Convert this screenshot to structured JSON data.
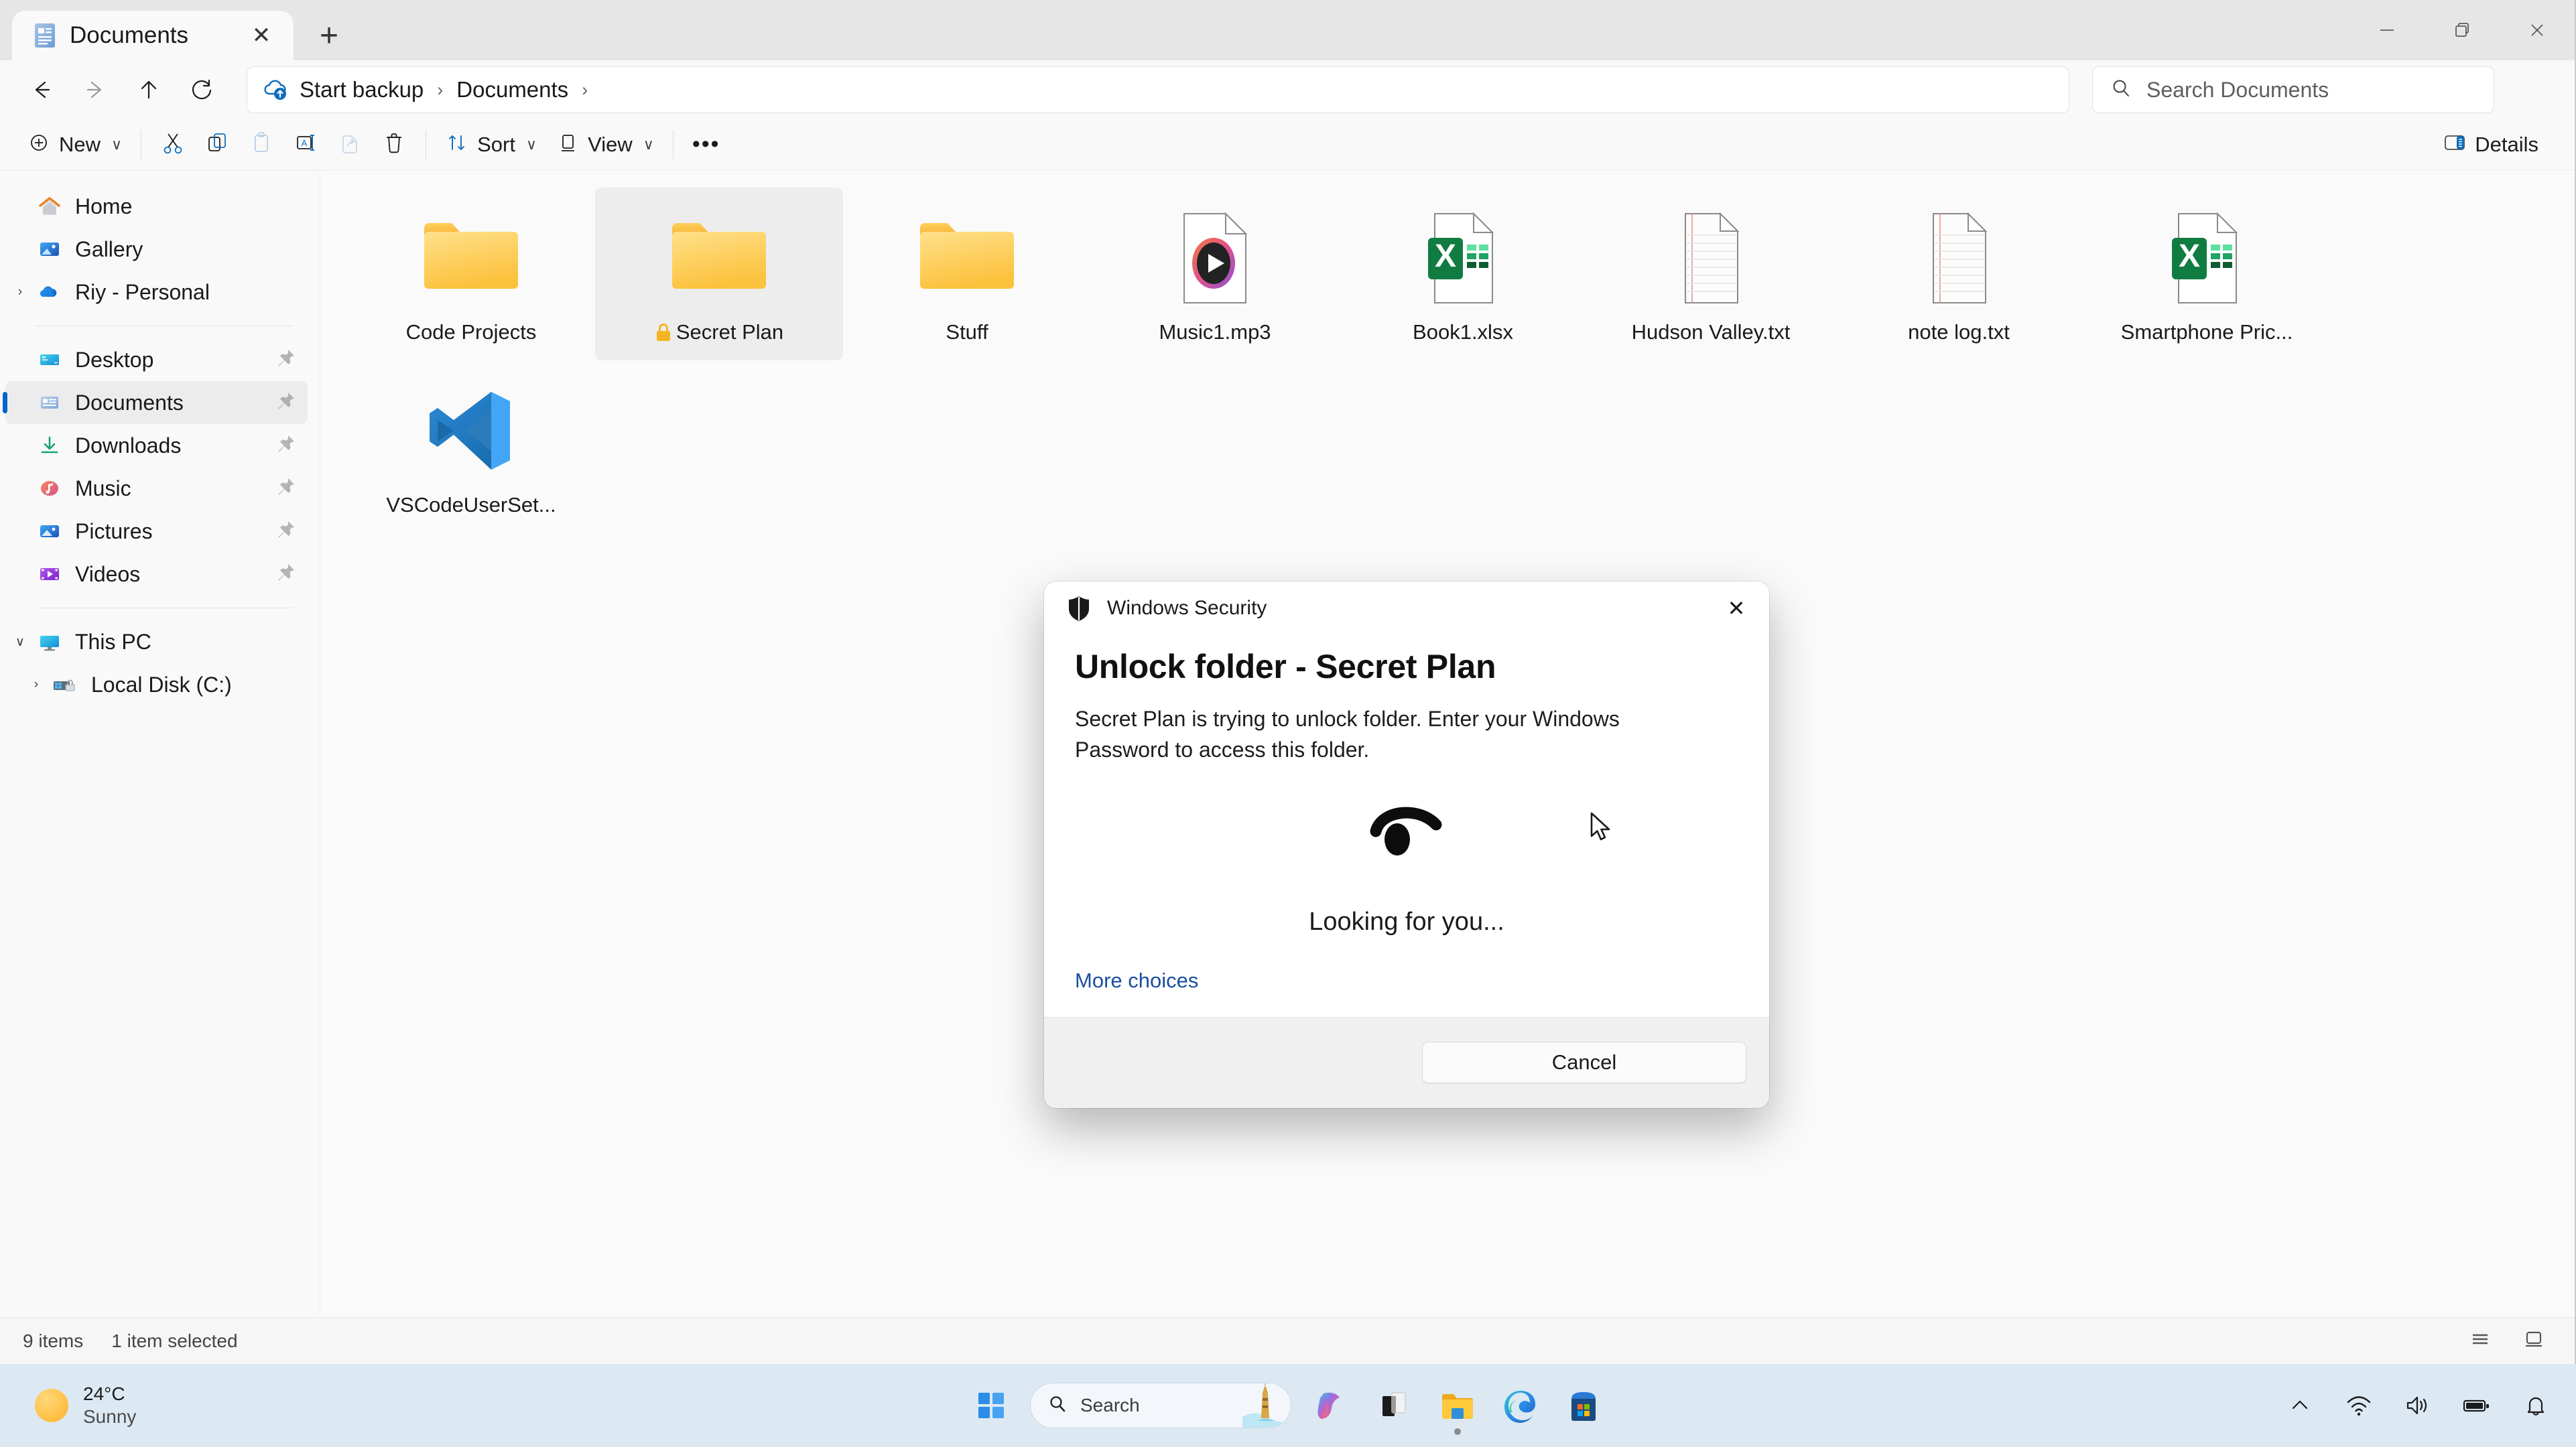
{
  "window": {
    "tab": {
      "label": "Documents",
      "icon": "documents-file-icon",
      "close_glyph": "✕"
    },
    "new_tab_glyph": "+",
    "controls": {
      "minimize": "minimize-icon",
      "maximize": "restore-icon",
      "close": "close-icon"
    }
  },
  "navbar": {
    "back": "back-arrow-icon",
    "forward": "forward-arrow-icon",
    "up": "up-arrow-icon",
    "refresh": "refresh-icon",
    "breadcrumbs": [
      {
        "label": "Start backup",
        "icon": "onedrive-backup-icon"
      },
      {
        "label": "Documents",
        "icon": ""
      }
    ],
    "separator": "›"
  },
  "search": {
    "placeholder": "Search Documents",
    "icon": "search-icon"
  },
  "toolbar": {
    "new_label": "New",
    "new_icon": "plus-circle-icon",
    "cut_icon": "scissors-icon",
    "copy_icon": "copy-icon",
    "paste_icon": "paste-icon",
    "rename_icon": "rename-icon",
    "share_icon": "share-icon",
    "delete_icon": "trash-icon",
    "sort_label": "Sort",
    "sort_icon": "sort-icon",
    "view_label": "View",
    "view_icon": "view-icon",
    "more_label": "•••",
    "details_label": "Details",
    "details_icon": "details-pane-icon",
    "chevron": "∨"
  },
  "sidebar": {
    "items": [
      {
        "name": "home",
        "label": "Home",
        "icon": "home-icon",
        "expander": "",
        "pinned": false,
        "selected": false,
        "indent": 1
      },
      {
        "name": "gallery",
        "label": "Gallery",
        "icon": "gallery-icon",
        "expander": "",
        "pinned": false,
        "selected": false,
        "indent": 1
      },
      {
        "name": "riy-personal",
        "label": "Riy - Personal",
        "icon": "onedrive-icon",
        "expander": "›",
        "pinned": false,
        "selected": false,
        "indent": 1
      },
      {
        "name": "divider-1",
        "label": "",
        "icon": "divider",
        "expander": "",
        "pinned": false,
        "selected": false,
        "indent": 0
      },
      {
        "name": "desktop",
        "label": "Desktop",
        "icon": "desktop-icon",
        "expander": "",
        "pinned": true,
        "selected": false,
        "indent": 1
      },
      {
        "name": "documents",
        "label": "Documents",
        "icon": "documents-icon",
        "expander": "",
        "pinned": true,
        "selected": true,
        "indent": 1
      },
      {
        "name": "downloads",
        "label": "Downloads",
        "icon": "downloads-icon",
        "expander": "",
        "pinned": true,
        "selected": false,
        "indent": 1
      },
      {
        "name": "music",
        "label": "Music",
        "icon": "music-icon",
        "expander": "",
        "pinned": true,
        "selected": false,
        "indent": 1
      },
      {
        "name": "pictures",
        "label": "Pictures",
        "icon": "pictures-icon",
        "expander": "",
        "pinned": true,
        "selected": false,
        "indent": 1
      },
      {
        "name": "videos",
        "label": "Videos",
        "icon": "videos-icon",
        "expander": "",
        "pinned": true,
        "selected": false,
        "indent": 1
      },
      {
        "name": "divider-2",
        "label": "",
        "icon": "divider",
        "expander": "",
        "pinned": false,
        "selected": false,
        "indent": 0
      },
      {
        "name": "this-pc",
        "label": "This PC",
        "icon": "this-pc-icon",
        "expander": "∨",
        "pinned": false,
        "selected": false,
        "indent": 1
      },
      {
        "name": "local-disk-c",
        "label": "Local Disk (C:)",
        "icon": "local-disk-icon",
        "expander": "›",
        "pinned": false,
        "selected": false,
        "indent": 2
      }
    ]
  },
  "files": [
    {
      "name": "Code Projects",
      "icon": "folder-icon",
      "selected": false,
      "lock": false
    },
    {
      "name": "Secret Plan",
      "icon": "folder-icon",
      "selected": true,
      "lock": true,
      "lock_glyph": "🔒"
    },
    {
      "name": "Stuff",
      "icon": "folder-icon",
      "selected": false,
      "lock": false
    },
    {
      "name": "Music1.mp3",
      "icon": "media-player-file-icon",
      "selected": false,
      "lock": false
    },
    {
      "name": "Book1.xlsx",
      "icon": "excel-file-icon",
      "selected": false,
      "lock": false
    },
    {
      "name": "Hudson Valley.txt",
      "icon": "text-file-icon",
      "selected": false,
      "lock": false
    },
    {
      "name": "note log.txt",
      "icon": "text-file-icon",
      "selected": false,
      "lock": false
    },
    {
      "name": "Smartphone Pric...",
      "icon": "excel-file-icon",
      "selected": false,
      "lock": false
    },
    {
      "name": "VSCodeUserSet...",
      "icon": "vscode-file-icon",
      "selected": false,
      "lock": false
    }
  ],
  "status": {
    "item_count": "9 items",
    "selection": "1 item selected",
    "list_view_icon": "list-view-icon",
    "grid_view_icon": "tile-view-icon"
  },
  "dialog": {
    "title": "Windows Security",
    "title_icon": "shield-icon",
    "close_glyph": "✕",
    "heading": "Unlock folder - Secret Plan",
    "description": "Secret Plan is trying to unlock folder. Enter your Windows Password to access this folder.",
    "hello_icon": "windows-hello-face-icon",
    "hello_status": "Looking for you...",
    "more_choices_label": "More choices",
    "cancel_label": "Cancel"
  },
  "taskbar": {
    "weather": {
      "temperature": "24°C",
      "condition": "Sunny",
      "icon": "sun-icon"
    },
    "start_icon": "windows-start-icon",
    "search": {
      "placeholder": "Search",
      "icon": "search-icon",
      "thumbnail": "lighthouse-thumbnail-icon"
    },
    "apps": [
      {
        "name": "copilot",
        "icon": "copilot-icon",
        "running": false
      },
      {
        "name": "task-view",
        "icon": "task-view-icon",
        "running": false
      },
      {
        "name": "file-explorer",
        "icon": "file-explorer-icon",
        "running": true
      },
      {
        "name": "edge",
        "icon": "edge-icon",
        "running": false
      },
      {
        "name": "microsoft-store",
        "icon": "microsoft-store-icon",
        "running": false
      }
    ],
    "tray": [
      {
        "name": "show-hidden-icons",
        "icon": "chevron-up-icon"
      },
      {
        "name": "network",
        "icon": "wifi-icon"
      },
      {
        "name": "volume",
        "icon": "speaker-icon"
      },
      {
        "name": "battery",
        "icon": "battery-icon"
      },
      {
        "name": "notifications",
        "icon": "bell-icon"
      }
    ]
  },
  "colors": {
    "accent": "#0066cc",
    "folder": "#ffc83d",
    "excel_green": "#107c41",
    "taskbar_bg": "#dce9f3",
    "link": "#1a4fa0"
  }
}
